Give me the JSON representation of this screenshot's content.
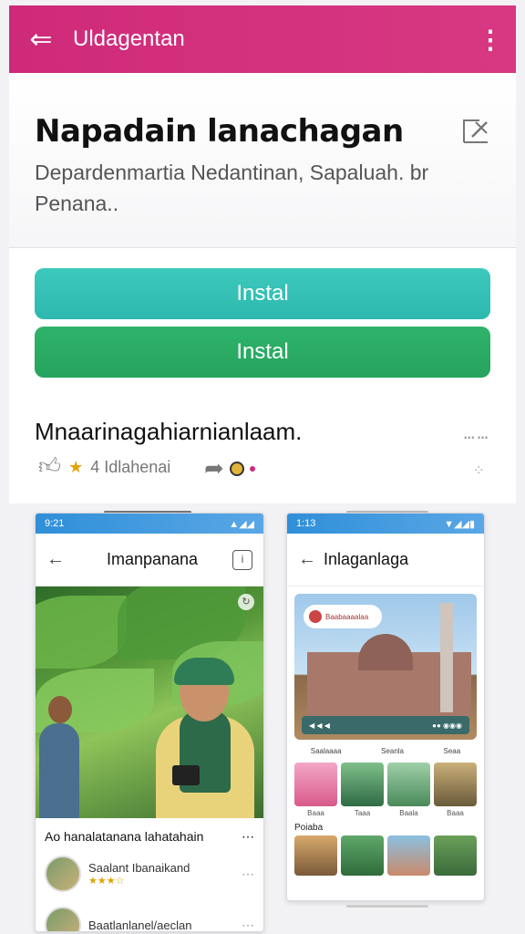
{
  "appbar": {
    "back_icon": "arrow-left-icon",
    "title": "Uldagentan",
    "menu_icon": "more-vert-icon",
    "color": "#cf2a7a"
  },
  "hero": {
    "headline": "Napadain lanachagan",
    "subtitle": "Depardenmartia Nedantinan, Sapaluah. br Penana..",
    "edit_icon": "edit-icon"
  },
  "actions": {
    "primary_label": "Instal",
    "secondary_label": "Instal",
    "primary_color": "#3ec9bd",
    "secondary_color": "#2fb36a"
  },
  "section": {
    "title": "Mnaarinagahiarnianlaam.",
    "meta_label": "4  Idlahenai",
    "right_text": "ⵈⵈ",
    "drag_text": "⁘"
  },
  "phone_left": {
    "status_time": "9:21",
    "status_icons": "▲◢◢",
    "title": "Imanpanana",
    "feed_title": "Ao hanalatanana lahatahain",
    "feed_more": "⋯",
    "items": [
      {
        "name": "Saalant Ibanaikand",
        "rating": "★★★☆",
        "more": "⋯"
      },
      {
        "name": "Baatlanlanel/aeclan",
        "rating": "",
        "more": "⋯"
      }
    ]
  },
  "phone_right": {
    "status_time": "1:13",
    "status_icons": "▼◢◢▮",
    "title": "Inlaganlaga",
    "pill_text": "Baabaaaalaa",
    "bar_left": "◀ ◀ ◀",
    "bar_right": "●● ◉◉◉",
    "tabs": [
      "Saalaaaa",
      "Seanla",
      "Seaa"
    ],
    "row1": [
      "Baaa",
      "Taaa",
      "Baala",
      "Baaa"
    ],
    "section2": "Poiaba"
  }
}
